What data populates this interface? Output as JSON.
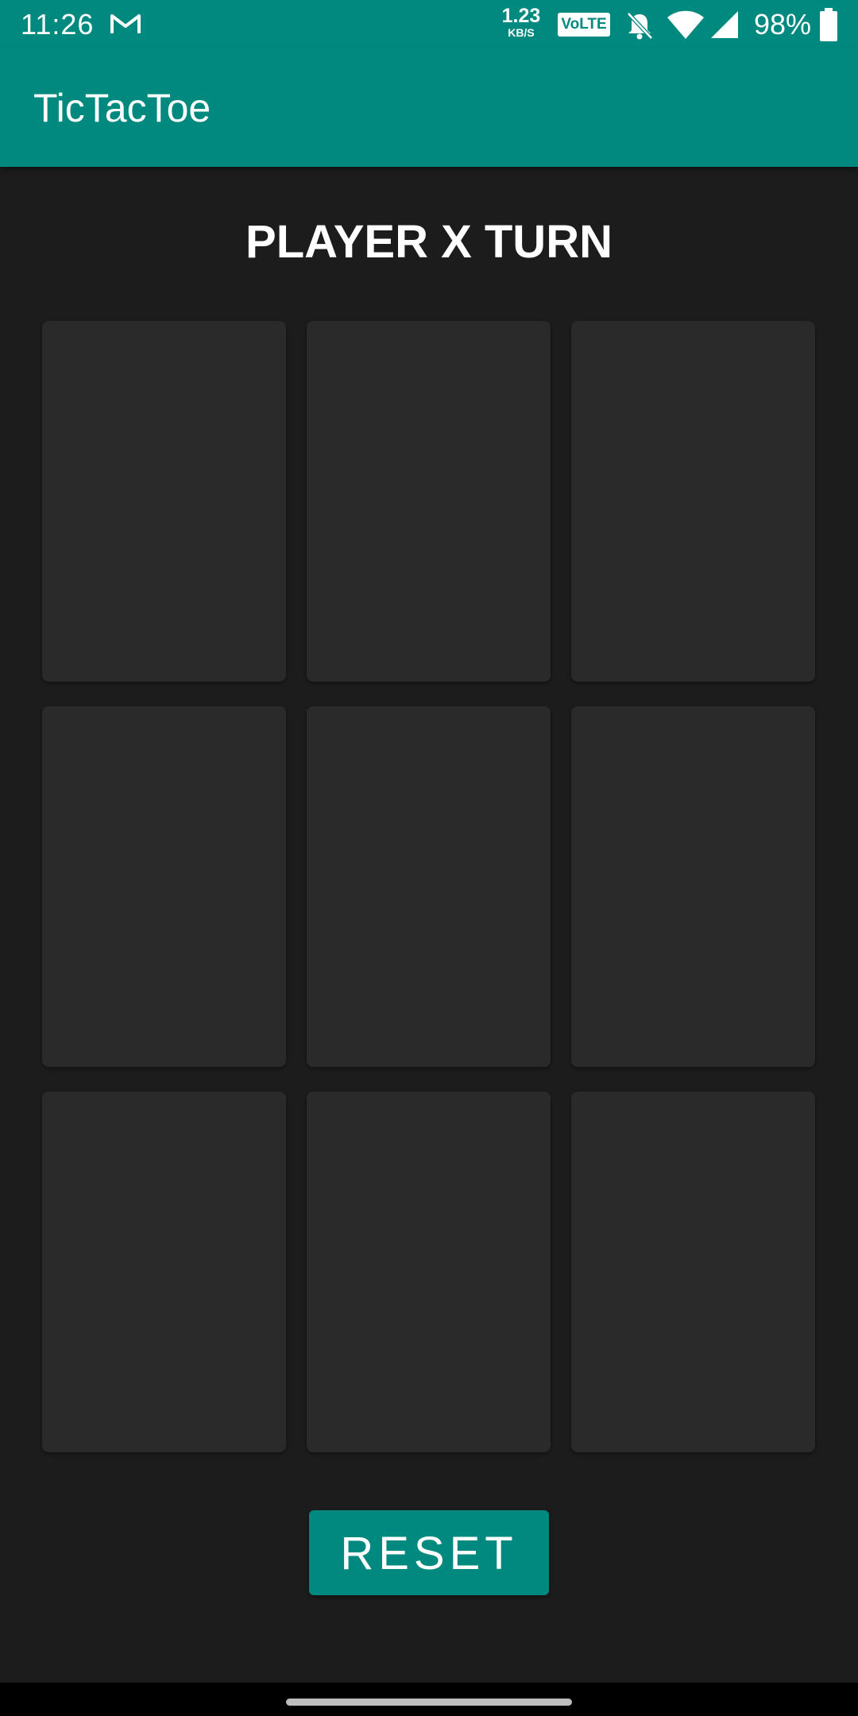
{
  "status_bar": {
    "time": "11:26",
    "notification_icon": "gmail-icon",
    "net_speed_value": "1.23",
    "net_speed_unit": "KB/S",
    "volte_label": "VoLTE",
    "icons": [
      "bell-off-icon",
      "wifi-icon",
      "signal-icon",
      "battery-icon"
    ],
    "battery_percent": "98%"
  },
  "app_bar": {
    "title": "TicTacToe"
  },
  "game": {
    "turn_text": "PLAYER X TURN",
    "cells": [
      "",
      "",
      "",
      "",
      "",
      "",
      "",
      "",
      ""
    ]
  },
  "controls": {
    "reset_label": "RESET"
  },
  "colors": {
    "primary": "#00897f",
    "background": "#1c1c1c",
    "cell": "#2a2a2a",
    "text": "#ffffff"
  }
}
